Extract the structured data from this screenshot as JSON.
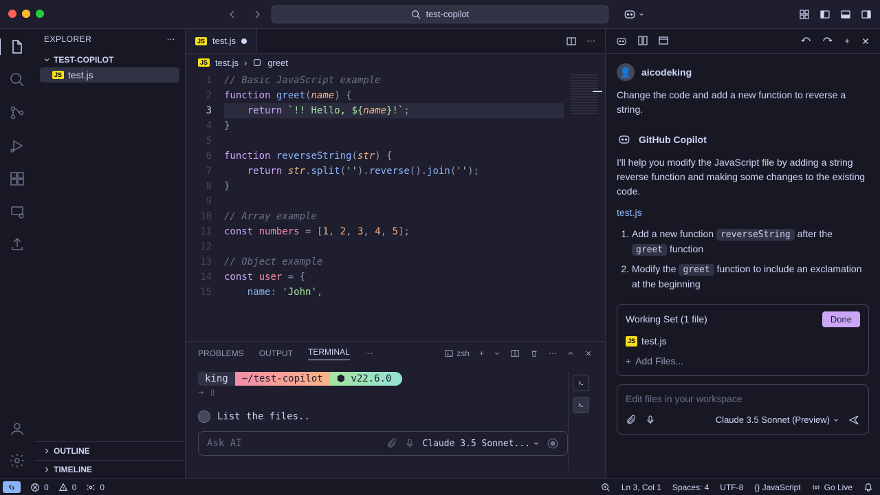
{
  "titlebar": {
    "search_text": "test-copilot"
  },
  "sidebar": {
    "header": "EXPLORER",
    "project": "TEST-COPILOT",
    "files": [
      {
        "name": "test.js",
        "badge": "JS"
      }
    ],
    "outline": "OUTLINE",
    "timeline": "TIMELINE"
  },
  "tabs": [
    {
      "name": "test.js",
      "badge": "JS",
      "dirty": true
    }
  ],
  "breadcrumb": {
    "file": "test.js",
    "badge": "JS",
    "symbol": "greet"
  },
  "code": {
    "lines": [
      1,
      2,
      3,
      4,
      5,
      6,
      7,
      8,
      9,
      10,
      11,
      12,
      13,
      14,
      15
    ],
    "current": 3
  },
  "panel": {
    "tabs": [
      "PROBLEMS",
      "OUTPUT",
      "TERMINAL"
    ],
    "active": "TERMINAL",
    "shell": "zsh",
    "prompt_user": "king",
    "prompt_path": "~/test-copilot",
    "prompt_node": "⬢ v22.6.0",
    "ai_suggestion": "List the files..",
    "ai_placeholder": "Ask AI",
    "ai_model": "Claude 3.5 Sonnet..."
  },
  "copilot": {
    "user_name": "aicodeking",
    "user_msg": "Change the code and add a new function to reverse a string.",
    "bot_name": "GitHub Copilot",
    "bot_msg": "I'll help you modify the JavaScript file by adding a string reverse function and making some changes to the existing code.",
    "file_link": "test.js",
    "list_item_1_pre": "Add a new function ",
    "list_item_1_code": "reverseString",
    "list_item_1_post": " after the ",
    "list_item_1_code2": "greet",
    "list_item_1_end": " function",
    "list_item_2_pre": "Modify the ",
    "list_item_2_code": "greet",
    "list_item_2_post": " function to include an exclamation at the beginning",
    "ws_title": "Working Set (1 file)",
    "done": "Done",
    "ws_file": "test.js",
    "ws_badge": "JS",
    "add_files": "Add Files...",
    "input_placeholder": "Edit files in your workspace",
    "model": "Claude 3.5 Sonnet (Preview)"
  },
  "statusbar": {
    "errors": "0",
    "warnings": "0",
    "ports": "0",
    "cursor": "Ln 3, Col 1",
    "spaces": "Spaces: 4",
    "encoding": "UTF-8",
    "lang": "{} JavaScript",
    "golive": "Go Live"
  }
}
